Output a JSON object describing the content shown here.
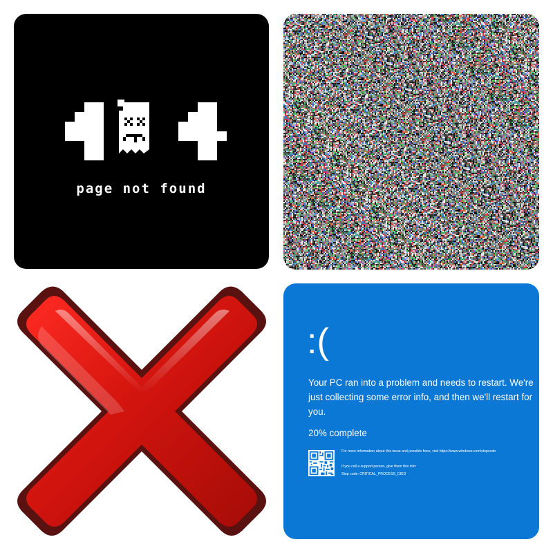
{
  "tiles": {
    "not_found": {
      "code_left": "4",
      "code_right": "4",
      "label": "page not found",
      "icon": "broken-file-sad-face-icon"
    },
    "noise": {
      "description_icon": "static-noise-image"
    },
    "error_x": {
      "icon": "red-x-icon"
    },
    "bsod": {
      "face": ":(",
      "message": "Your PC ran into a problem and needs to restart. We're just collecting some error info, and then we'll restart for you.",
      "progress": "20% complete",
      "more_info": "For more information about this issue and possible fixes, visit https://www.windows.com/stopcode",
      "support": "If you call a support person, give them this info:",
      "stop_code": "Stop code: CRITICAL_PROCESS_DIED",
      "icon": "qr-code-icon"
    }
  },
  "colors": {
    "bsod_blue": "#0b78d6",
    "x_red": "#d91a12",
    "x_dark": "#6a1410"
  }
}
